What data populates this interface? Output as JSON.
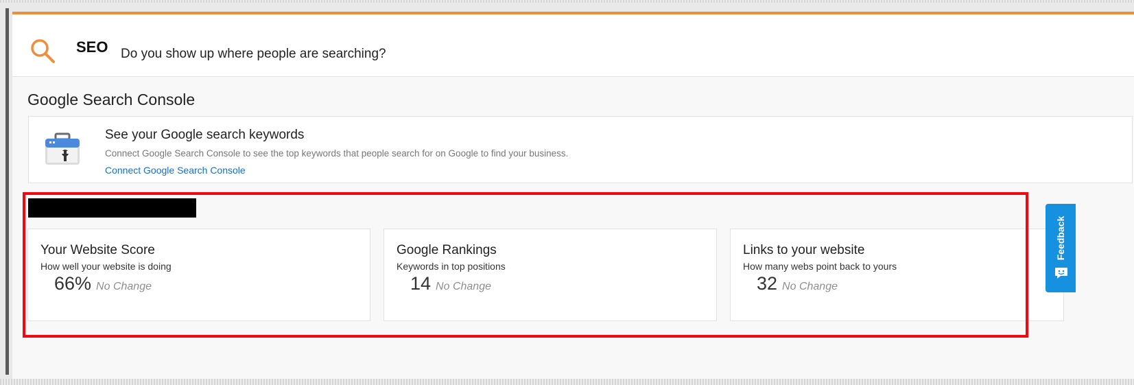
{
  "colors": {
    "accent": "#ee8e3c",
    "link": "#1a6fc4",
    "highlight": "#ee0a14",
    "feedback": "#1691e0"
  },
  "header": {
    "icon": "search-icon",
    "title": "SEO",
    "subtitle": "Do you show up where people are searching?"
  },
  "gsc": {
    "section_title": "Google Search Console",
    "icon": "search-console-toolbox-icon",
    "heading": "See your Google search keywords",
    "description": "Connect Google Search Console to see the top keywords that people search for on Google to find your business.",
    "link": "Connect Google Search Console"
  },
  "stats": [
    {
      "title": "Your Website Score",
      "description": "How well your website is doing",
      "value": "66%",
      "change": "No Change"
    },
    {
      "title": "Google Rankings",
      "description": "Keywords in top positions",
      "value": "14",
      "change": "No Change"
    },
    {
      "title": "Links to your website",
      "description": "How many webs point back to yours",
      "value": "32",
      "change": "No Change"
    }
  ],
  "feedback": {
    "label": "Feedback",
    "icon": "chat-icon"
  }
}
